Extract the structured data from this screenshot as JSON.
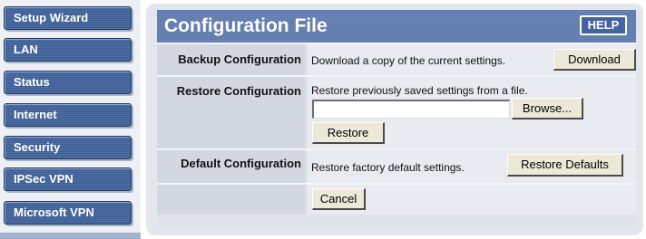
{
  "sidebar": {
    "items": [
      {
        "label": "Setup Wizard"
      },
      {
        "label": "LAN"
      },
      {
        "label": "Status"
      },
      {
        "label": "Internet"
      },
      {
        "label": "Security"
      },
      {
        "label": "IPSec VPN"
      },
      {
        "label": "Microsoft VPN"
      }
    ]
  },
  "header": {
    "title": "Configuration File",
    "help_label": "HELP"
  },
  "backup": {
    "label": "Backup Configuration",
    "description": "Download a copy of the current settings.",
    "button": "Download"
  },
  "restore": {
    "label": "Restore Configuration",
    "description": "Restore previously saved settings from a file.",
    "file_value": "",
    "browse_button": "Browse...",
    "button": "Restore"
  },
  "defaults": {
    "label": "Default Configuration",
    "description": "Restore factory default settings.",
    "button": "Restore Defaults"
  },
  "footer": {
    "cancel_button": "Cancel"
  },
  "colors": {
    "nav_button": "#3e5d92",
    "title_bar": "#5d78aa",
    "help_button": "#4563a2",
    "label_cell": "#d3d7df",
    "content_cell": "#e9ebf0"
  }
}
